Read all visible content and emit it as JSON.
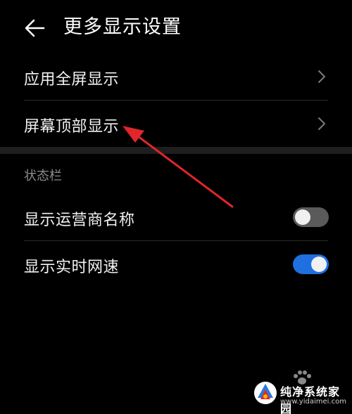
{
  "header": {
    "back_icon": "arrow-left-icon",
    "title": "更多显示设置"
  },
  "menu": {
    "items": [
      {
        "label": "应用全屏显示",
        "icon": "chevron-right-icon"
      },
      {
        "label": "屏幕顶部显示",
        "icon": "chevron-right-icon"
      }
    ]
  },
  "status_bar_section": {
    "title": "状态栏",
    "toggles": [
      {
        "label": "显示运营商名称",
        "on": false
      },
      {
        "label": "显示实时网速",
        "on": true
      }
    ]
  },
  "colors": {
    "background": "#000000",
    "toggle_on": "#1f6fe0",
    "toggle_off": "#5a5a5a",
    "annotation_arrow": "#e0262b"
  },
  "watermark": {
    "title": "纯净系统家园",
    "url": "www.yidaimei.com"
  }
}
